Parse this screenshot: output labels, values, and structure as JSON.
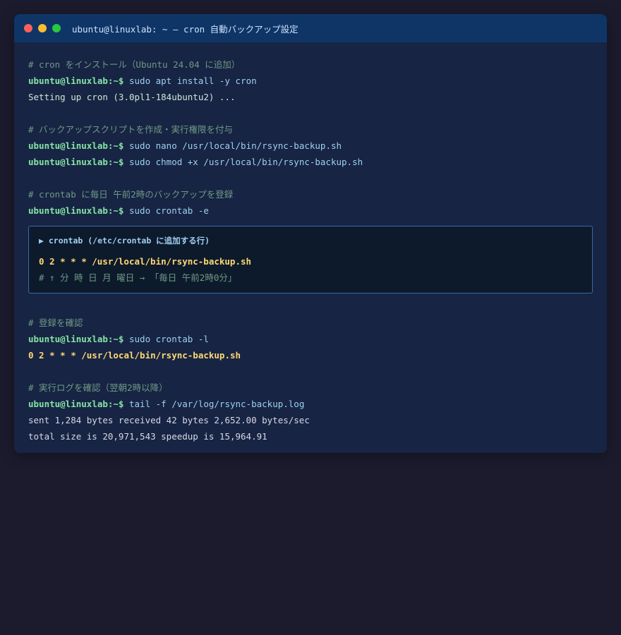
{
  "window": {
    "title": "ubuntu@linuxlab: ~ — cron 自動バックアップ設定"
  },
  "prompt": "ubuntu@linuxlab:~$",
  "section1": {
    "comment": "# cron をインストール（Ubuntu 24.04 に追加）",
    "cmd": "sudo apt install -y cron",
    "output": "Setting up cron (3.0pl1-184ubuntu2) ..."
  },
  "section2": {
    "comment": "# バックアップスクリプトを作成・実行権限を付与",
    "cmd1": "sudo nano /usr/local/bin/rsync-backup.sh",
    "cmd2": "sudo chmod +x /usr/local/bin/rsync-backup.sh"
  },
  "section3": {
    "comment": "# crontab に毎日 午前2時のバックアップを登録",
    "cmd": "sudo crontab -e",
    "box": {
      "heading": "▶ crontab (/etc/crontab に追加する行)",
      "entry": "0 2 * * * /usr/local/bin/rsync-backup.sh",
      "note": "# ↑ 分 時 日 月 曜日 → 「毎日 午前2時0分」"
    }
  },
  "section4": {
    "comment": "# 登録を確認",
    "cmd": "sudo crontab -l",
    "output": "0 2 * * * /usr/local/bin/rsync-backup.sh"
  },
  "section5": {
    "comment": "# 実行ログを確認（翌朝2時以降）",
    "cmd": "tail -f /var/log/rsync-backup.log",
    "output1": "sent 1,284 bytes received 42 bytes 2,652.00 bytes/sec",
    "output2": "total size is 20,971,543 speedup is 15,964.91"
  }
}
